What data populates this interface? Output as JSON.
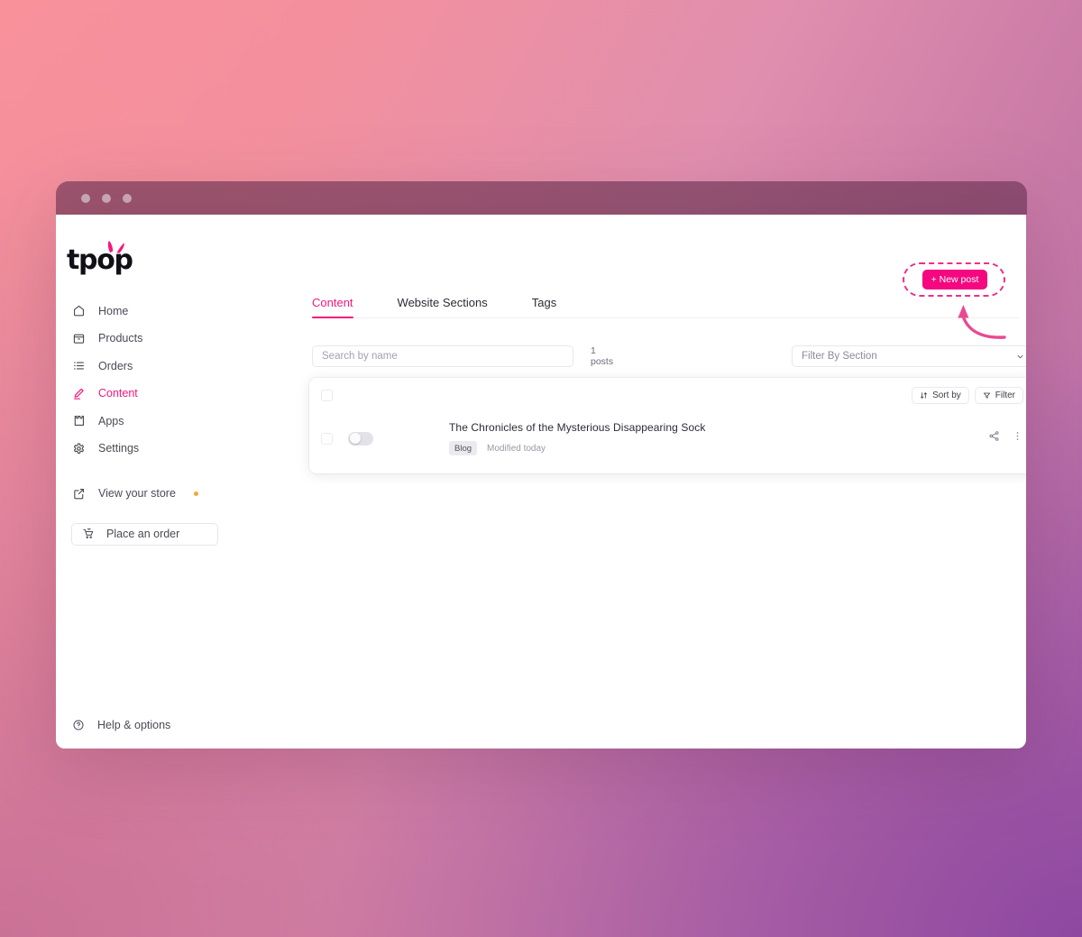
{
  "window": {
    "traffic_lights": [
      "close",
      "minimize",
      "maximize"
    ]
  },
  "brand": {
    "logo_text": "tpop",
    "accent": "#f5177f"
  },
  "sidebar": {
    "items": [
      {
        "label": "Home",
        "icon": "home-icon",
        "active": false
      },
      {
        "label": "Products",
        "icon": "box-icon",
        "active": false
      },
      {
        "label": "Orders",
        "icon": "list-icon",
        "active": false
      },
      {
        "label": "Content",
        "icon": "pencil-icon",
        "active": true
      },
      {
        "label": "Apps",
        "icon": "puzzle-icon",
        "active": false
      },
      {
        "label": "Settings",
        "icon": "gear-icon",
        "active": false
      }
    ],
    "store_link": {
      "label": "View your store",
      "icon": "external-link-icon",
      "dot_color": "#f0a93a"
    },
    "order_button": {
      "label": "Place an order",
      "icon": "cart-icon"
    },
    "help": {
      "label": "Help & options",
      "icon": "question-circle-icon"
    }
  },
  "main": {
    "tabs": [
      {
        "label": "Content",
        "active": true
      },
      {
        "label": "Website Sections",
        "active": false
      },
      {
        "label": "Tags",
        "active": false
      }
    ],
    "search": {
      "placeholder": "Search by name",
      "value": ""
    },
    "count": {
      "number": "1",
      "unit": "posts"
    },
    "section_filter": {
      "label": "Filter By Section",
      "chevron": "chevron-down-icon"
    },
    "card_actions": [
      {
        "label": "Sort by",
        "icon": "sort-icon"
      },
      {
        "label": "Filter",
        "icon": "funnel-icon"
      }
    ],
    "posts": [
      {
        "title": "The Chronicles of the Mysterious Disappearing Sock",
        "badge": "Blog",
        "modified": "Modified today",
        "published": false,
        "actions": [
          "share-icon",
          "more-vertical-icon"
        ]
      }
    ]
  },
  "cta": {
    "label": "+ New post",
    "highlight_color": "#ee2e88"
  }
}
